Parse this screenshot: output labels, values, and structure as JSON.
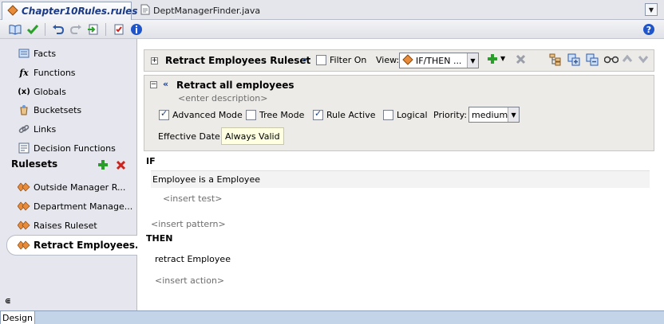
{
  "tabs": [
    {
      "label": "Chapter10Rules.rules",
      "active": true
    },
    {
      "label": "DeptManagerFinder.java",
      "active": false
    }
  ],
  "navigator": {
    "items": [
      {
        "label": "Facts",
        "icon": "facts-icon"
      },
      {
        "label": "Functions",
        "icon": "functions-icon"
      },
      {
        "label": "Globals",
        "icon": "globals-icon"
      },
      {
        "label": "Bucketsets",
        "icon": "bucketsets-icon"
      },
      {
        "label": "Links",
        "icon": "links-icon"
      },
      {
        "label": "Decision Functions",
        "icon": "decision-functions-icon"
      }
    ],
    "rulesets_header": "Rulesets",
    "rulesets": [
      {
        "label": "Outside Manager R..."
      },
      {
        "label": "Department Manage..."
      },
      {
        "label": "Raises Ruleset"
      },
      {
        "label": "Retract Employees...",
        "selected": true
      }
    ]
  },
  "ruleset": {
    "title": "Retract Employees Ruleset",
    "filter_label": "Filter On",
    "view_label": "View:",
    "view_value": "IF/THEN ..."
  },
  "rule": {
    "name": "Retract all employees",
    "description_placeholder": "<enter description>",
    "advanced_mode_label": "Advanced Mode",
    "tree_mode_label": "Tree Mode",
    "rule_active_label": "Rule Active",
    "logical_label": "Logical",
    "priority_label": "Priority:",
    "priority_value": "medium",
    "effective_date_label": "Effective Date:",
    "effective_date_value": "Always Valid",
    "advanced_mode_checked": true,
    "tree_mode_checked": false,
    "rule_active_checked": true,
    "logical_checked": false
  },
  "if_block": {
    "label": "IF",
    "pattern": "Employee is a Employee",
    "insert_test": "<insert test>",
    "insert_pattern": "<insert pattern>"
  },
  "then_block": {
    "label": "THEN",
    "action": "retract Employee",
    "insert_action": "<insert action>"
  },
  "bottom_tab": "Design",
  "colors": {
    "accent_blue": "#1b3a86",
    "add_green": "#2a9d2a",
    "delete_red": "#d0221c"
  }
}
